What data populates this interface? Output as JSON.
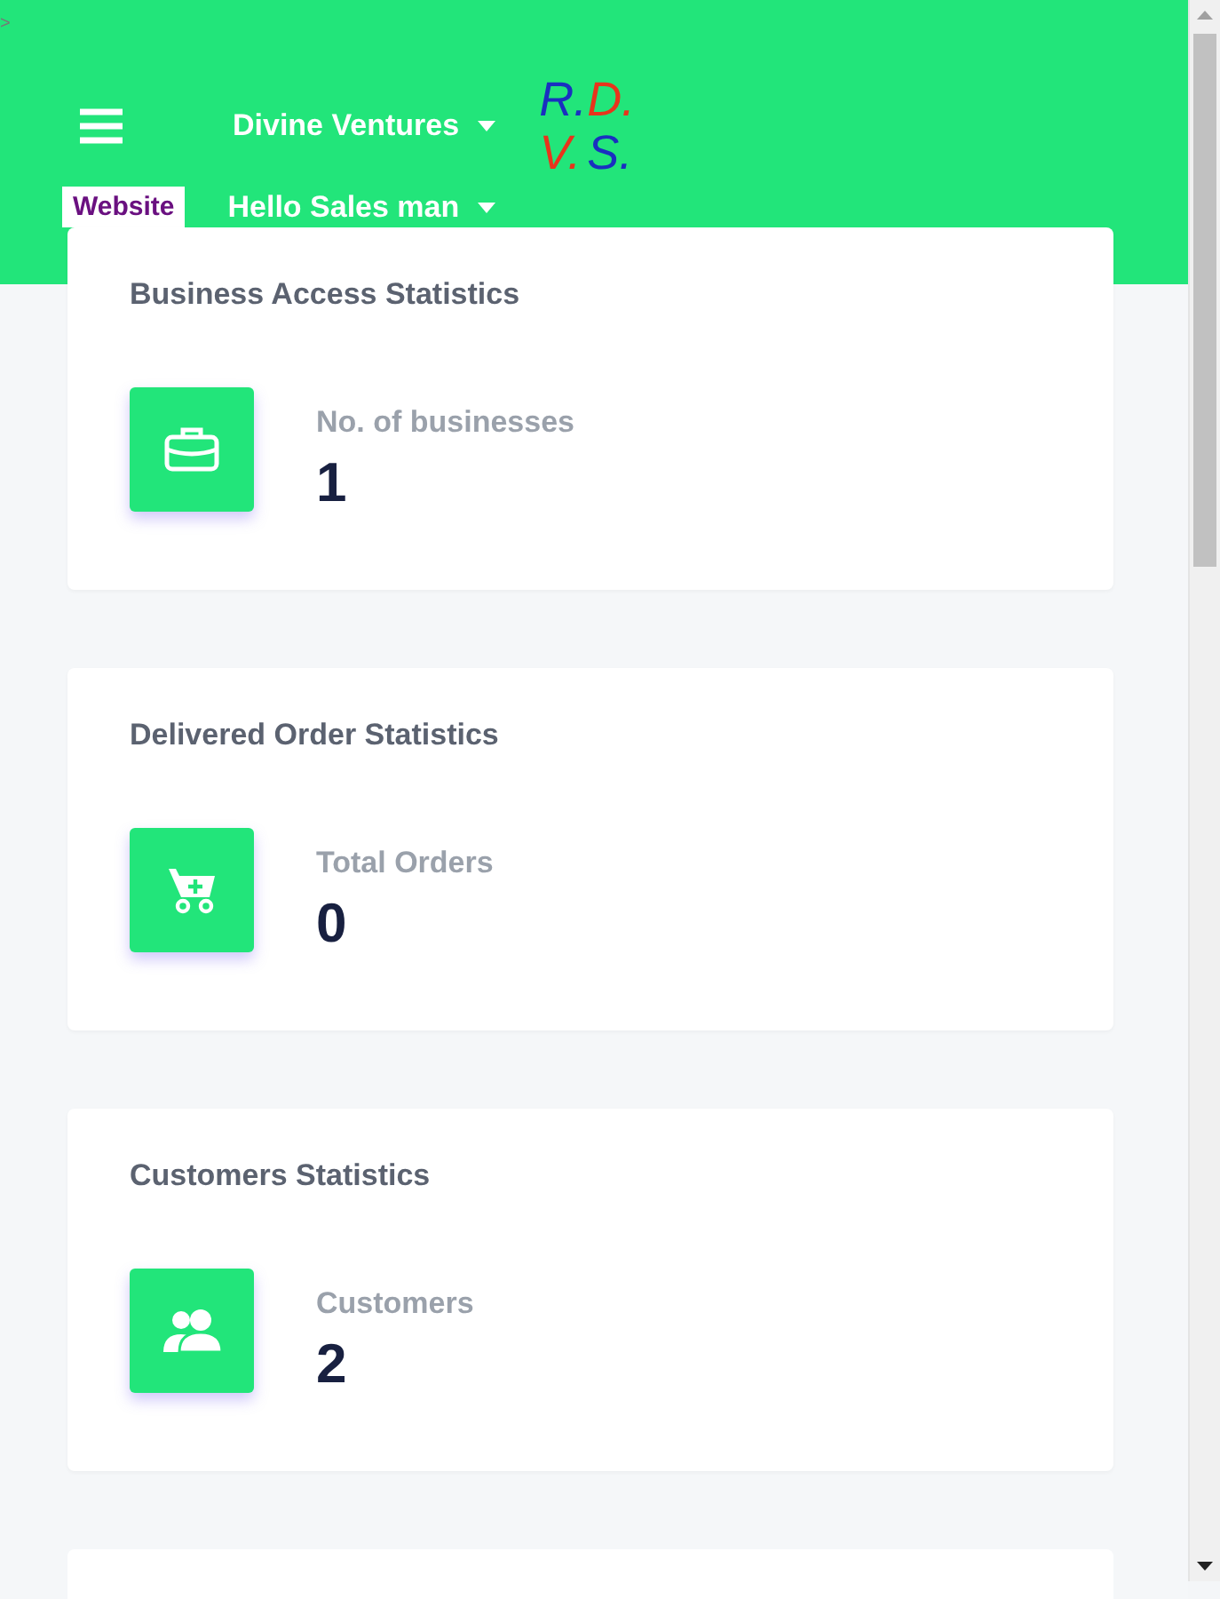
{
  "corner_mark": ">",
  "header": {
    "brand": "Divine Ventures",
    "logo": [
      {
        "text": "R.",
        "color": "#1a2fc0"
      },
      {
        "text": "D.",
        "color": "#e8341c"
      },
      {
        "text": "V.",
        "color": "#e8341c"
      },
      {
        "text": "S.",
        "color": "#1a2fc0"
      }
    ],
    "website": "Website",
    "user": "Hello Sales man"
  },
  "cards": [
    {
      "title": "Business Access Statistics",
      "kind": "briefcase",
      "label": "No. of businesses",
      "value": "1"
    },
    {
      "title": "Delivered Order Statistics",
      "kind": "cart",
      "label": "Total Orders",
      "value": "0"
    },
    {
      "title": "Customers Statistics",
      "kind": "users",
      "label": "Customers",
      "value": "2"
    }
  ],
  "partial_card": true
}
